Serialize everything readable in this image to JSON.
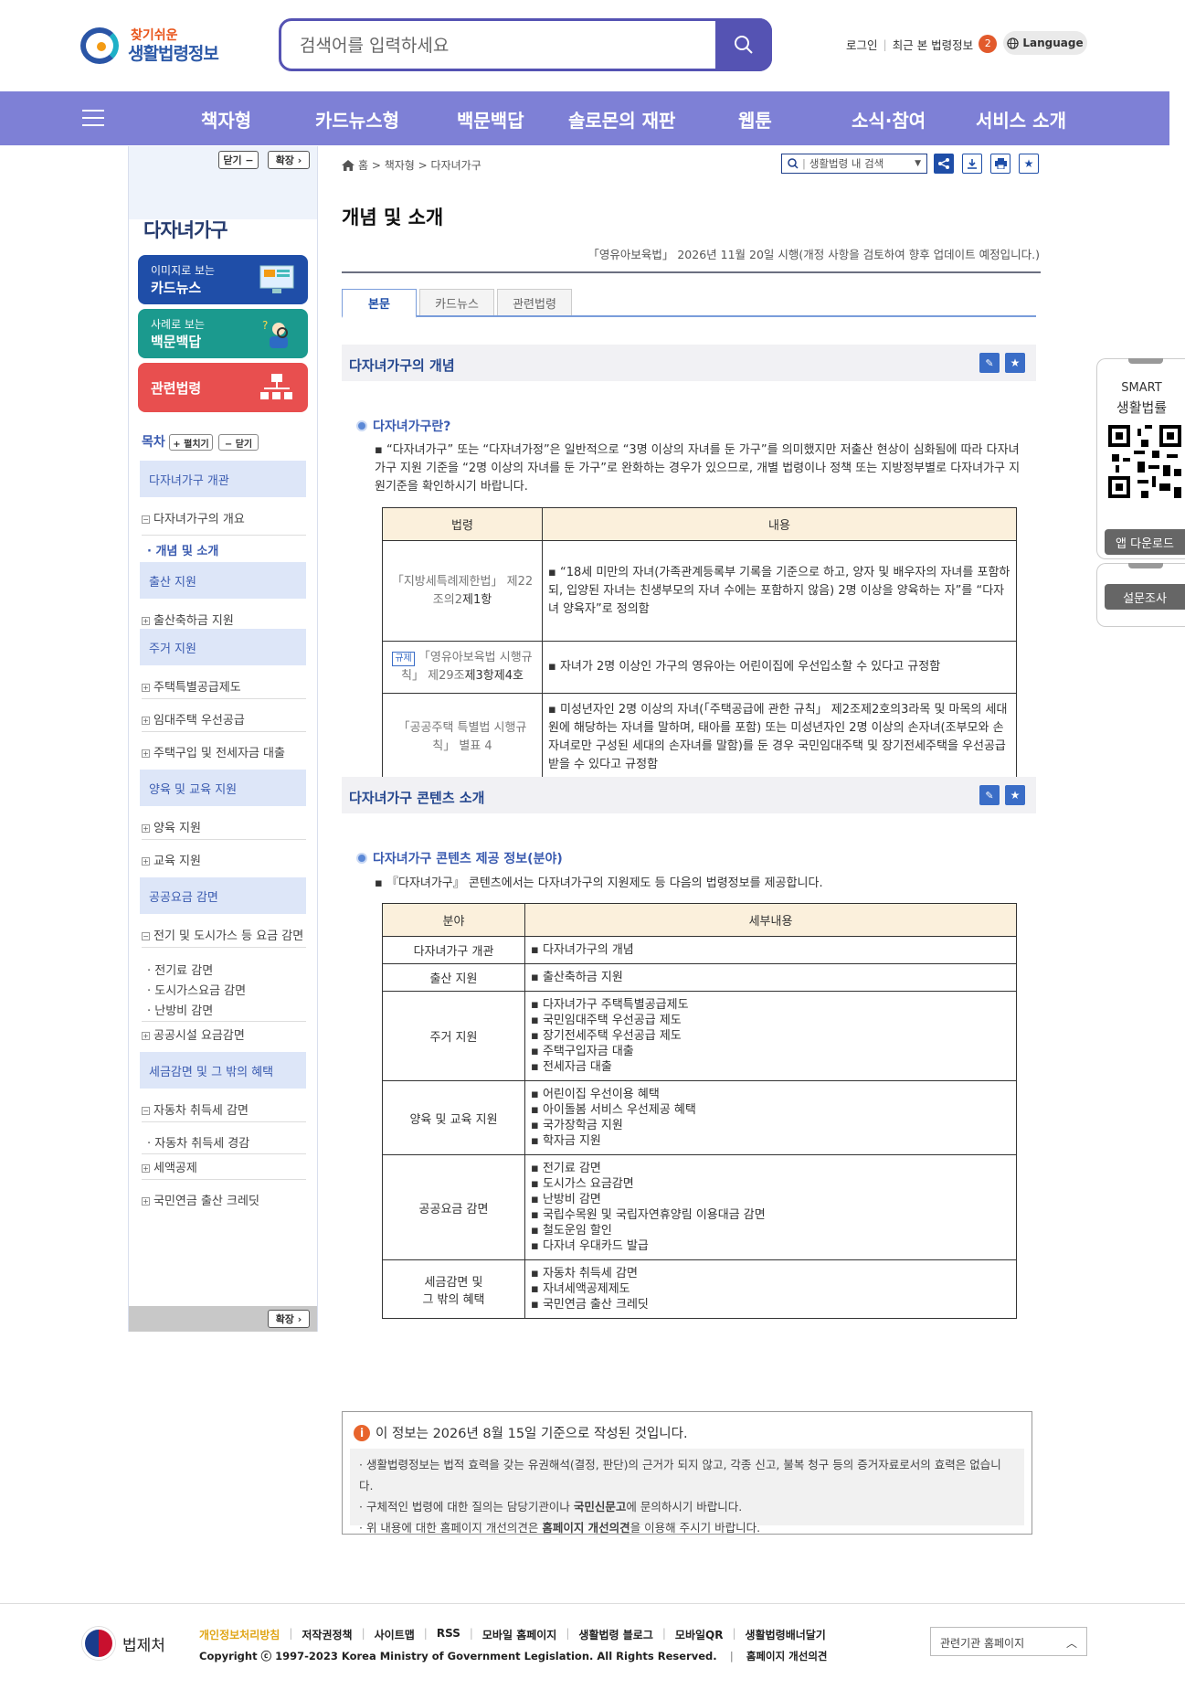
{
  "header": {
    "logo_line1": "찾기쉬운",
    "logo_line2": "생활법령정보",
    "search_placeholder": "검색어를 입력하세요",
    "login": "로그인",
    "recent": "최근 본 법령정보",
    "recent_count": "2",
    "language": "Language"
  },
  "nav": [
    "책자형",
    "카드뉴스형",
    "백문백답",
    "솔로몬의 재판",
    "웹툰",
    "소식·참여",
    "서비스 소개"
  ],
  "sidebar": {
    "close": "닫기 −",
    "expand": "확장 ›",
    "title": "다자녀가구",
    "promos": [
      {
        "small": "이미지로 보는",
        "big": "카드뉴스",
        "color": "#1f4ea8"
      },
      {
        "small": "사례로 보는",
        "big": "백문백답",
        "color": "#1b9a8e"
      },
      {
        "small": "",
        "big": "관련법령",
        "color": "#e84f4f"
      }
    ],
    "toc_label": "목차",
    "toc_open": "+ 펼치기",
    "toc_close": "− 닫기",
    "toc": {
      "cat1": "다자녀가구 개관",
      "r1": "다자녀가구의 개요",
      "r2": "개념 및 소개",
      "cat2": "출산 지원",
      "r3": "출산축하금 지원",
      "cat3": "주거 지원",
      "r4": "주택특별공급제도",
      "r5": "임대주택 우선공급",
      "r6": "주택구입 및 전세자금 대출",
      "cat4": "양육 및 교육 지원",
      "r7": "양육 지원",
      "r8": "교육 지원",
      "cat5": "공공요금 감면",
      "r9": "전기 및 도시가스 등 요금 감면",
      "r10": "전기료 감면",
      "r11": "도시가스요금 감면",
      "r12": "난방비 감면",
      "r13": "공공시설 요금감면",
      "cat6": "세금감면 및 그 밖의 혜택",
      "r14": "자동차 취득세 감면",
      "r15": "자동차 취득세 경감",
      "r16": "세액공제",
      "r17": "국민연금 출산 크레딧"
    },
    "bottom_expand": "확장 ›"
  },
  "main": {
    "breadcrumb": "홈 > 책자형 > 다자녀가구",
    "inner_search": "생활법령 내 검색",
    "title": "개념 및 소개",
    "effective": "「영유아보육법」 2026년 11월 20일 시행(개정 사항을 검토하여 향후 업데이트 예정입니다.)",
    "tabs": [
      "본문",
      "카드뉴스",
      "관련법령"
    ],
    "sec1": {
      "head": "다자녀가구의 개념",
      "sub": "다자녀가구란?",
      "para": "“다자녀가구” 또는 “다자녀가정”은 일반적으로 “3명 이상의 자녀를 둔 가구”를 의미했지만 저출산 현상이 심화됨에 따라 다자녀 가구 지원 기준을 “2명 이상의 자녀를 둔 가구”로 완화하는 경우가 있으므로, 개별 법령이나 정책 또는 지방정부별로 다자녀가구 지원기준을 확인하시기 바랍니다.",
      "col_law": "법령",
      "col_content": "내용",
      "rows": [
        {
          "law1": "「지방세특례제한법」 제22",
          "law2": "조의2",
          "law3": "제1항",
          "content": "“18세 미만의 자녀(가족관계등록부 기록을 기준으로 하고, 양자 및 배우자의 자녀를 포함하되, 입양된 자녀는 친생부모의 자녀 수에는 포함하지 않음) 2명 이상을 양육하는 자”를 “다자녀 양육자”로 정의함"
        },
        {
          "tag": "규제",
          "law1": "「영유아보육법 시행규",
          "law2": "칙」 제29조",
          "law3": "제3항제4호",
          "content": "자녀가 2명 이상인 가구의 영유아는 어린이집에 우선입소할 수 있다고 규정함"
        },
        {
          "law1": "「공공주택 특별법 시행규",
          "law2": "칙」 별표 4",
          "law3": "",
          "content": "미성년자인 2명 이상의 자녀(「주택공급에 관한 규칙」 제2조제2호의3라목 및 마목의 세대원에 해당하는 자녀를 말하며, 태아를 포함) 또는 미성년자인 2명 이상의 손자녀(조부모와 손자녀로만 구성된 세대의 손자녀를 말함)를 둔 경우 국민임대주택 및 장기전세주택을 우선공급받을 수 있다고 규정함"
        }
      ]
    },
    "sec2": {
      "head": "다자녀가구 콘텐츠 소개",
      "sub": "다자녀가구 콘텐츠 제공 정보(분야)",
      "para": "『다자녀가구』 콘텐츠에서는 다자녀가구의 지원제도 등 다음의 법령정보를 제공합니다.",
      "col_area": "분야",
      "col_detail": "세부내용",
      "rows": [
        {
          "area": "다자녀가구 개관",
          "items": [
            "다자녀가구의 개념"
          ]
        },
        {
          "area": "출산 지원",
          "items": [
            "출산축하금 지원"
          ]
        },
        {
          "area": "주거 지원",
          "items": [
            "다자녀가구 주택특별공급제도",
            "국민임대주택 우선공급 제도",
            "장기전세주택 우선공급 제도",
            "주택구입자금 대출",
            "전세자금 대출"
          ]
        },
        {
          "area": "양육 및 교육 지원",
          "items": [
            "어린이집 우선이용 혜택",
            "아이돌봄 서비스 우선제공 혜택",
            "국가장학금 지원",
            "학자금 지원"
          ]
        },
        {
          "area": "공공요금 감면",
          "items": [
            "전기료 감면",
            "도시가스 요금감면",
            "난방비 감면",
            "국립수목원 및 국립자연휴양림 이용대금 감면",
            "철도운임 할인",
            "다자녀 우대카드 발급"
          ]
        },
        {
          "area": "세금감면 및\n그 밖의 혜택",
          "items": [
            "자동차 취득세 감면",
            "자녀세액공제제도",
            "국민연금 출산 크레딧"
          ]
        }
      ]
    },
    "notice": {
      "head": "이 정보는 2026년 8월 15일 기준으로 작성된 것입니다.",
      "l1": "생활법령정보는 법적 효력을 갖는 유권해석(결정, 판단)의 근거가 되지 않고, 각종 신고, 불복 청구 등의 증거자료로서의 효력은 없습니다.",
      "l2a": "구체적인 법령에 대한 질의는 담당기관이나 ",
      "l2b": "국민신문고",
      "l2c": "에 문의하시기 바랍니다.",
      "l3a": "위 내용에 대한 홈페이지 개선의견은 ",
      "l3b": "홈페이지 개선의견",
      "l3c": "을 이용해 주시기 바랍니다."
    }
  },
  "widgets": {
    "smart1": "SMART",
    "smart2": "생활법률",
    "app_download": "앱 다운로드",
    "survey": "설문조사"
  },
  "footer": {
    "org": "법제처",
    "links": [
      "개인정보처리방침",
      "저작권정책",
      "사이트맵",
      "RSS",
      "모바일 홈페이지",
      "생활법령 블로그",
      "모바일QR",
      "생활법령배너달기"
    ],
    "copyright": "Copyright ⓒ 1997-2023 Korea Ministry of Government Legislation. All Rights Reserved.",
    "improve": "홈페이지 개선의견",
    "related": "관련기관 홈페이지"
  }
}
